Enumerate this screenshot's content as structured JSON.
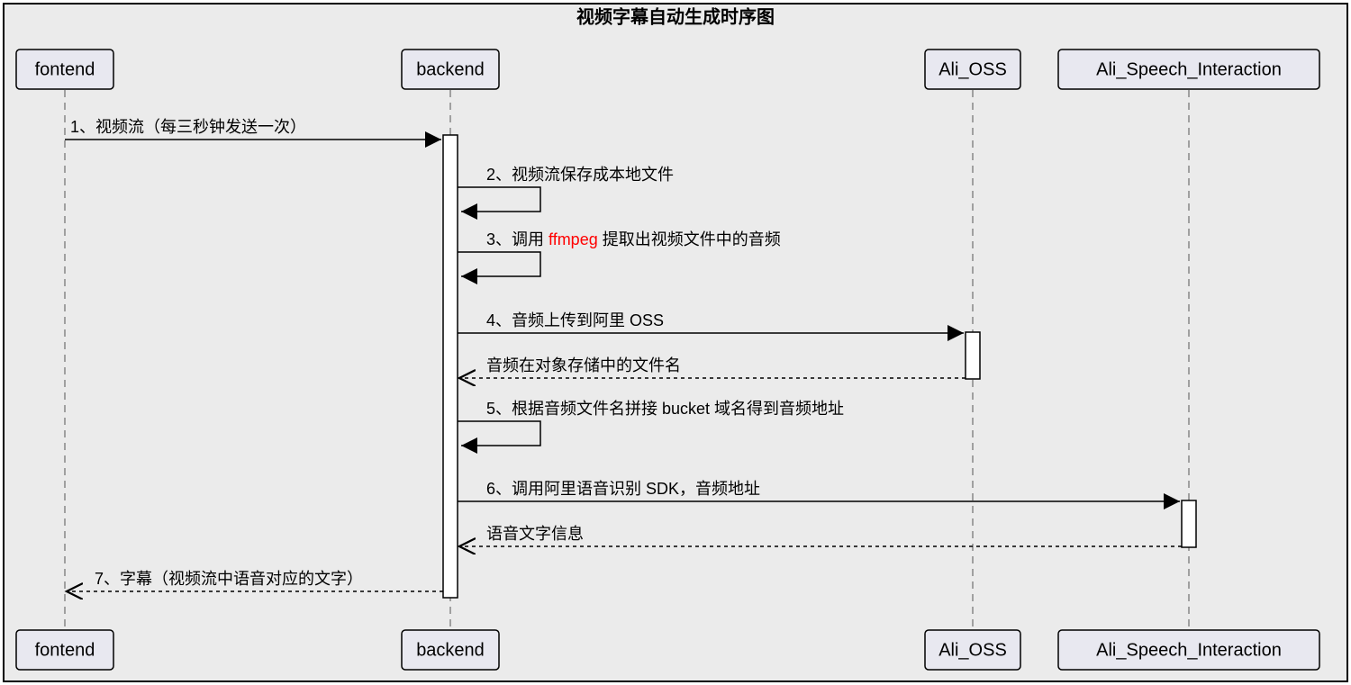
{
  "title": "视频字幕自动生成时序图",
  "participants": {
    "frontend": "fontend",
    "backend": "backend",
    "oss": "Ali_OSS",
    "speech": "Ali_Speech_Interaction"
  },
  "messages": {
    "m1": "1、视频流（每三秒钟发送一次）",
    "m2": "2、视频流保存成本地文件",
    "m3_prefix": "3、调用 ",
    "m3_highlight": "ffmpeg",
    "m3_suffix": " 提取出视频文件中的音频",
    "m4": "4、音频上传到阿里 OSS",
    "m4r": "音频在对象存储中的文件名",
    "m5": "5、根据音频文件名拼接 bucket 域名得到音频地址",
    "m6": "6、调用阿里语音识别 SDK，音频地址",
    "m6r": "语音文字信息",
    "m7": "7、字幕（视频流中语音对应的文字）"
  }
}
